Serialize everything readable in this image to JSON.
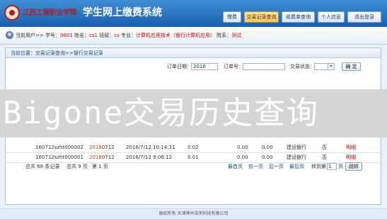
{
  "header": {
    "school_name": "江西工程职业学院",
    "title": "学生网上缴费系统",
    "nav": [
      {
        "label": "缴费",
        "active": false
      },
      {
        "label": "交易记录查询",
        "active": true
      },
      {
        "label": "收费单查询",
        "active": false
      },
      {
        "label": "个人信息",
        "active": false
      },
      {
        "label": "退出登录",
        "active": false
      }
    ]
  },
  "user": {
    "prefix": "当前用户>> 学号：",
    "id": "0001",
    "name_label": " 姓名：",
    "name": "cs1",
    "class_label": " 班级：",
    "class": "cs",
    "major_label": " 专业：",
    "major": "计算机应用技术（银行计算机应用）",
    "dept_label": " 院系：",
    "dept": "测试"
  },
  "breadcrumb": "当前位置：交易记录查询>>银行交易记录",
  "filter": {
    "date_label": "订单日期：",
    "date_value": "2016",
    "order_label": "订单号：",
    "order_value": "",
    "status_label": "交易状态：",
    "status_value": "",
    "confirm_label": "确 定"
  },
  "table": {
    "rows": [
      {
        "order_no": "160712szht000002",
        "date_prefix": "2016",
        "date_suffix": "0712",
        "time": "2016/7/12 10:14:31",
        "amount": "0.02",
        "v1": "0.00",
        "v2": "0.00",
        "bank": "建设银行",
        "status": "否",
        "action": "明细"
      },
      {
        "order_no": "160712szht000001",
        "date_prefix": "2016",
        "date_suffix": "0712",
        "time": "2016/7/12 9:06:12",
        "amount": "0.01",
        "v1": "0.00",
        "v2": "0.00",
        "bank": "建设银行",
        "status": "否",
        "action": "明细"
      }
    ]
  },
  "pager": {
    "total": "总共 68 条记录",
    "pages": "总共 9 页",
    "current": "第 1 页",
    "first": "最首页",
    "prev": "前一页",
    "next": "后一页",
    "last": "最后页",
    "goto_label": "转到第",
    "goto_value": "1",
    "page_unit": "页",
    "jump_label": "跳转"
  },
  "footer": "版权所有 天津神州浩天科技有限公司",
  "overlay_text": "Bigone交易历史查询",
  "colors": {
    "header_blue": "#1b5fae",
    "accent_red": "#d10000",
    "overlay_gray": "#d2d2d2"
  }
}
